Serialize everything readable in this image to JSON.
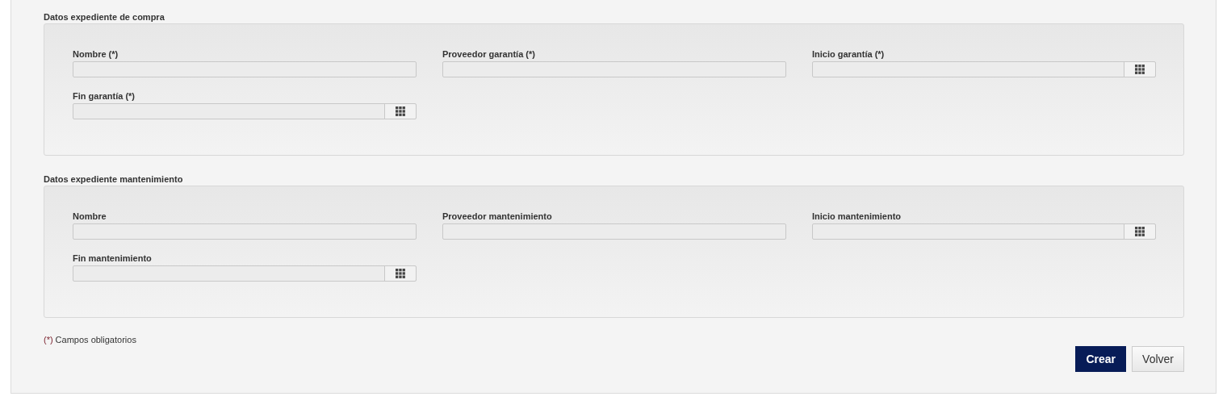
{
  "sections": [
    {
      "title": "Datos expediente de compra",
      "fields": [
        {
          "label": "Nombre (*)",
          "kind": "text"
        },
        {
          "label": "Proveedor garantía (*)",
          "kind": "text"
        },
        {
          "label": "Inicio garantía (*)",
          "kind": "date"
        },
        {
          "label": "Fin garantía (*)",
          "kind": "date"
        }
      ]
    },
    {
      "title": "Datos expediente mantenimiento",
      "fields": [
        {
          "label": "Nombre",
          "kind": "text"
        },
        {
          "label": "Proveedor mantenimiento",
          "kind": "text"
        },
        {
          "label": "Inicio mantenimiento",
          "kind": "date"
        },
        {
          "label": "Fin mantenimiento",
          "kind": "date"
        }
      ]
    }
  ],
  "note": {
    "marker": "(*)",
    "text": "Campos obligatorios"
  },
  "buttons": [
    {
      "label": "Crear",
      "kind": "primary"
    },
    {
      "label": "Volver",
      "kind": "secondary"
    }
  ]
}
